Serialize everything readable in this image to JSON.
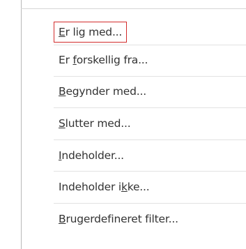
{
  "menu": {
    "items": [
      {
        "mnemonic": "E",
        "rest": "r lig med...",
        "selected": true
      },
      {
        "before": "Er ",
        "mnemonic": "f",
        "rest": "orskellig fra...",
        "selected": false
      },
      {
        "mnemonic": "B",
        "rest": "egynder med...",
        "selected": false
      },
      {
        "mnemonic": "S",
        "rest": "lutter med...",
        "selected": false
      },
      {
        "mnemonic": "I",
        "rest": "ndeholder...",
        "selected": false
      },
      {
        "before": "Indeholder i",
        "mnemonic": "k",
        "rest": "ke...",
        "selected": false
      },
      {
        "mnemonic": "B",
        "rest": "rugerdefineret filter...",
        "selected": false
      }
    ]
  },
  "colors": {
    "selection_outline": "#d22b2b",
    "text": "#333333",
    "separator": "#e2e2e2"
  }
}
